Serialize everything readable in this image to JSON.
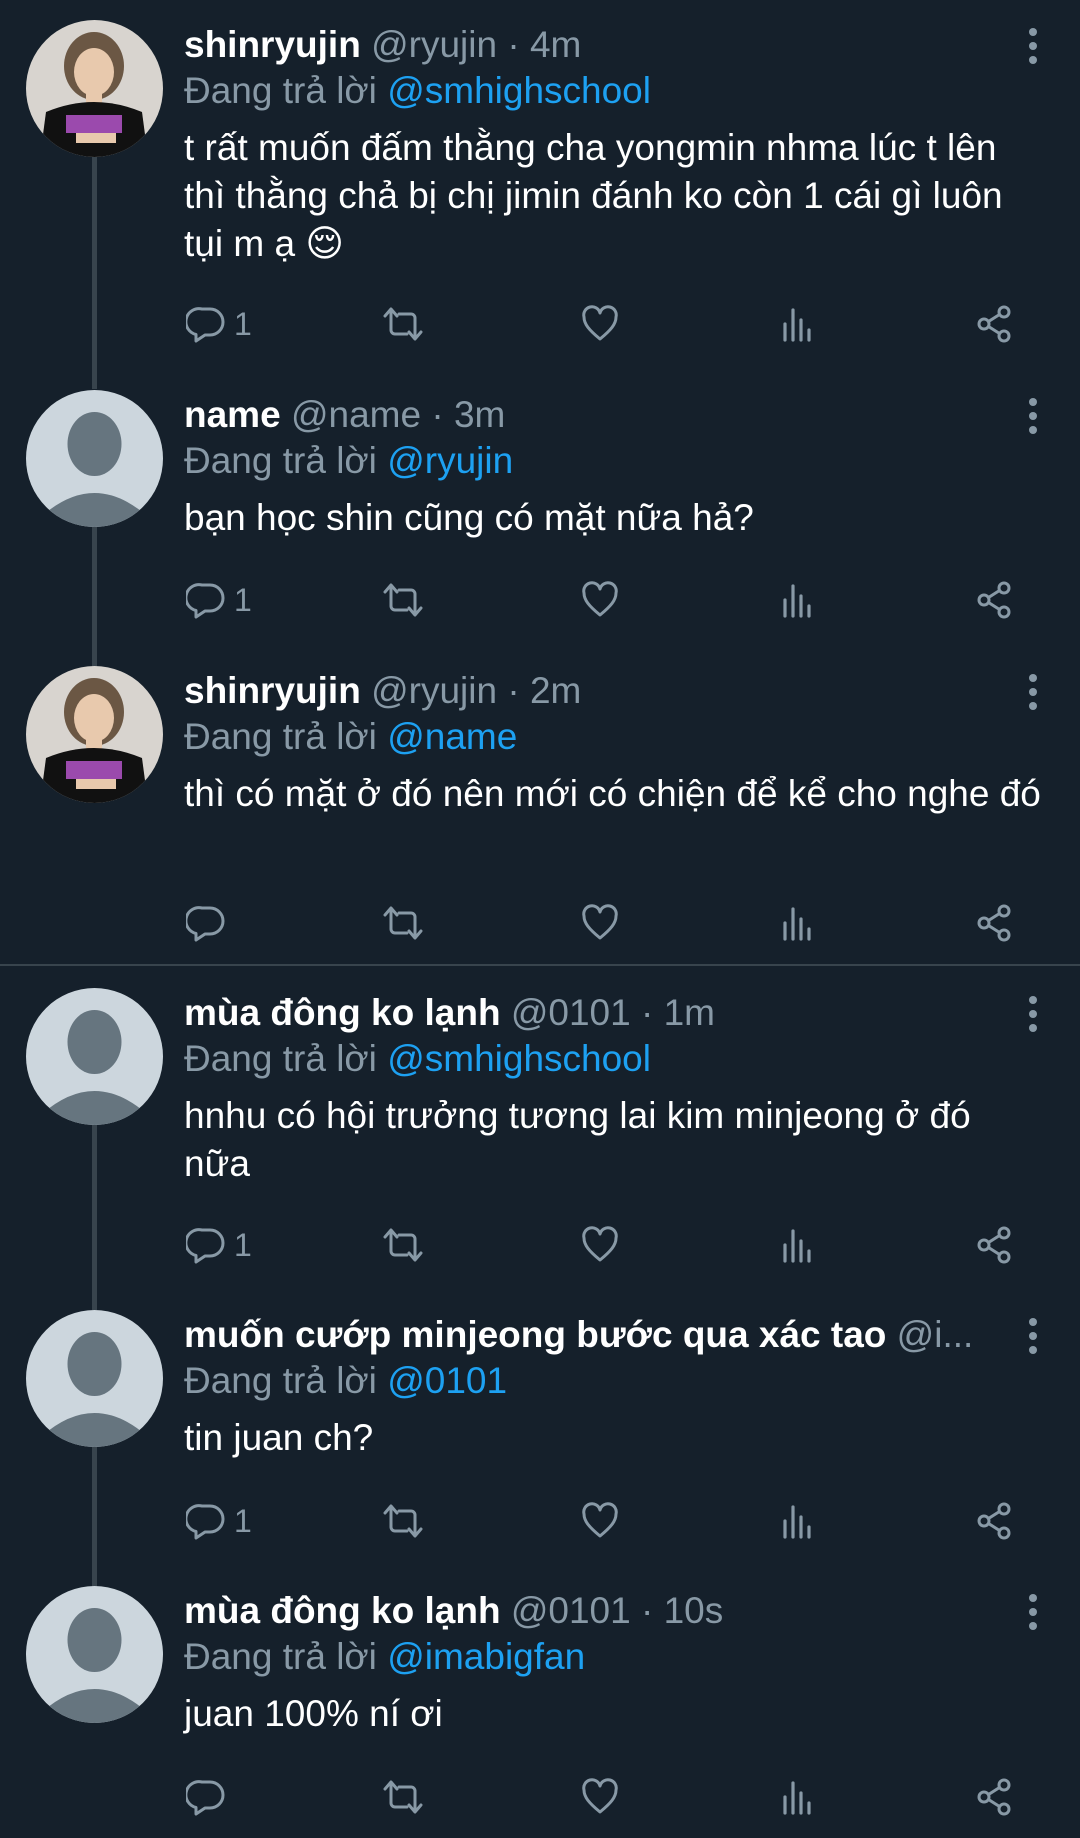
{
  "tweets": [
    {
      "name": "shinryujin",
      "handle": "@ryujin",
      "time": "· 4m",
      "reply_prefix": "Đang trả lời",
      "reply_to": "@smhighschool",
      "text": "t rất muốn đấm thằng cha yongmin nhma lúc t lên thì thằng chả bị chị jimin đánh ko còn 1 cái gì luôn tụi m ạ 😌",
      "reply_count": "1",
      "avatar": "photo"
    },
    {
      "name": "name",
      "handle": "@name",
      "time": "· 3m",
      "reply_prefix": "Đang trả lời",
      "reply_to": "@ryujin",
      "text": "bạn học shin cũng có mặt nữa hả?",
      "reply_count": "1",
      "avatar": "default"
    },
    {
      "name": "shinryujin",
      "handle": "@ryujin",
      "time": "· 2m",
      "reply_prefix": "Đang trả lời",
      "reply_to": "@name",
      "text": "thì có mặt ở đó nên mới có chiện để kể cho nghe đó",
      "reply_count": "",
      "avatar": "photo"
    },
    {
      "name": "mùa đông ko lạnh",
      "handle": "@0101",
      "time": "· 1m",
      "reply_prefix": "Đang trả lời",
      "reply_to": "@smhighschool",
      "text": "hnhu có hội trưởng tương lai kim minjeong ở đó nữa",
      "reply_count": "1",
      "avatar": "default"
    },
    {
      "name": "muốn cướp minjeong bước qua xác tao",
      "handle": "@i...",
      "time": "",
      "reply_prefix": "Đang trả lời",
      "reply_to": "@0101",
      "text": "tin juan ch?",
      "reply_count": "1",
      "avatar": "default"
    },
    {
      "name": "mùa đông ko lạnh",
      "handle": "@0101",
      "time": "· 10s",
      "reply_prefix": "Đang trả lời",
      "reply_to": "@imabigfan",
      "text": "juan 100% ní ơi",
      "reply_count": "",
      "avatar": "default"
    }
  ],
  "icons": [
    "reply-icon",
    "retweet-icon",
    "like-icon",
    "analytics-icon",
    "share-icon",
    "more-options-icon"
  ],
  "colors": {
    "background": "#15202b",
    "text": "#ffffff",
    "secondary": "#8899a6",
    "mention": "#1da1f2",
    "thread_line": "#38444d"
  }
}
